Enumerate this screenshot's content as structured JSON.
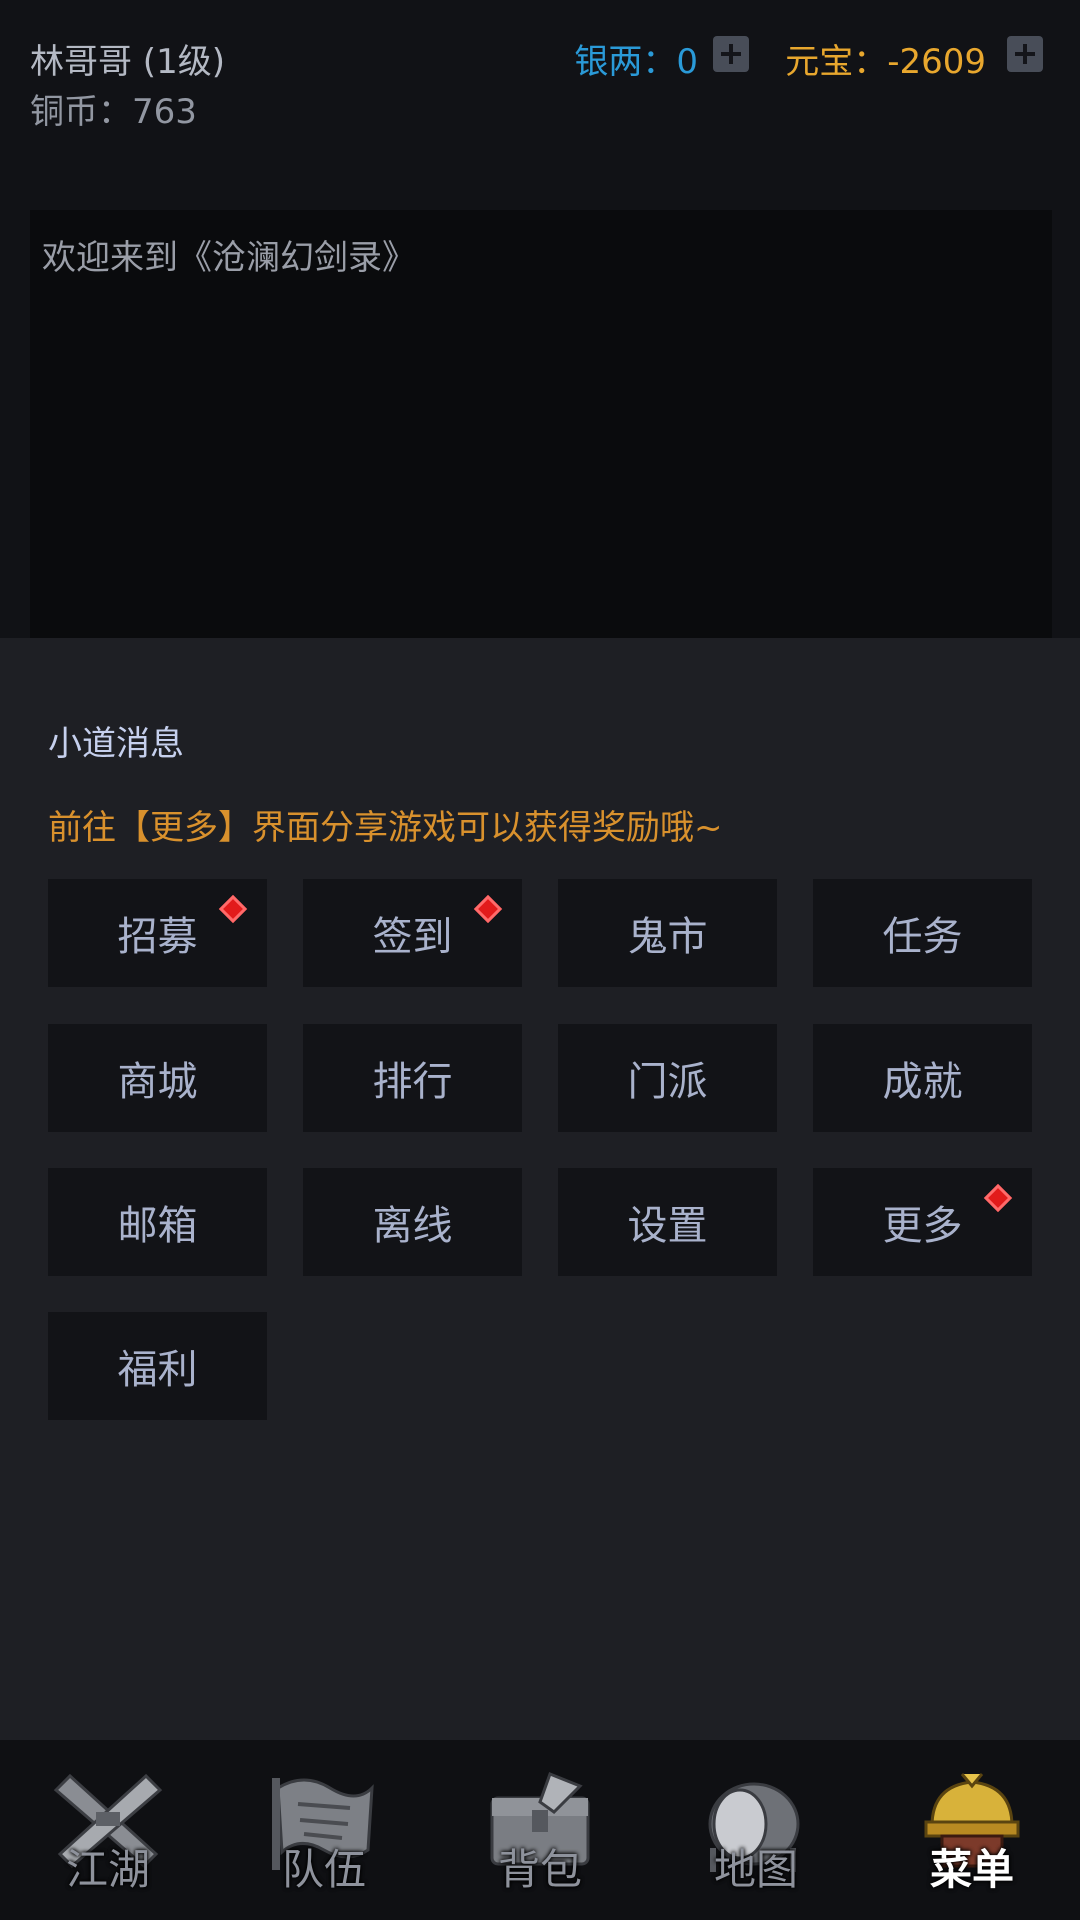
{
  "header": {
    "player_name": "林哥哥 (1级)",
    "copper": "铜币：763",
    "silver": "银两：0",
    "ingot": "元宝：-2609"
  },
  "log": {
    "welcome": "欢迎来到《沧澜幻剑录》"
  },
  "menu": {
    "section_title": "小道消息",
    "tip": "前往【更多】界面分享游戏可以获得奖励哦~",
    "buttons": [
      {
        "label": "招募",
        "badge": true
      },
      {
        "label": "签到",
        "badge": true
      },
      {
        "label": "鬼市",
        "badge": false
      },
      {
        "label": "任务",
        "badge": false
      },
      {
        "label": "商城",
        "badge": false
      },
      {
        "label": "排行",
        "badge": false
      },
      {
        "label": "门派",
        "badge": false
      },
      {
        "label": "成就",
        "badge": false
      },
      {
        "label": "邮箱",
        "badge": false
      },
      {
        "label": "离线",
        "badge": false
      },
      {
        "label": "设置",
        "badge": false
      },
      {
        "label": "更多",
        "badge": true
      },
      {
        "label": "福利",
        "badge": false
      }
    ]
  },
  "nav": {
    "items": [
      {
        "label": "江湖",
        "icon": "crossed-swords-icon",
        "active": false
      },
      {
        "label": "队伍",
        "icon": "banner-scroll-icon",
        "active": false
      },
      {
        "label": "背包",
        "icon": "chest-icon",
        "active": false
      },
      {
        "label": "地图",
        "icon": "drum-icon",
        "active": false
      },
      {
        "label": "菜单",
        "icon": "helmet-icon",
        "active": true
      }
    ]
  },
  "colors": {
    "silver": "#2a9ad8",
    "ingot": "#e8a72e",
    "tip": "#d9912d",
    "badge": "#e21b1b"
  }
}
